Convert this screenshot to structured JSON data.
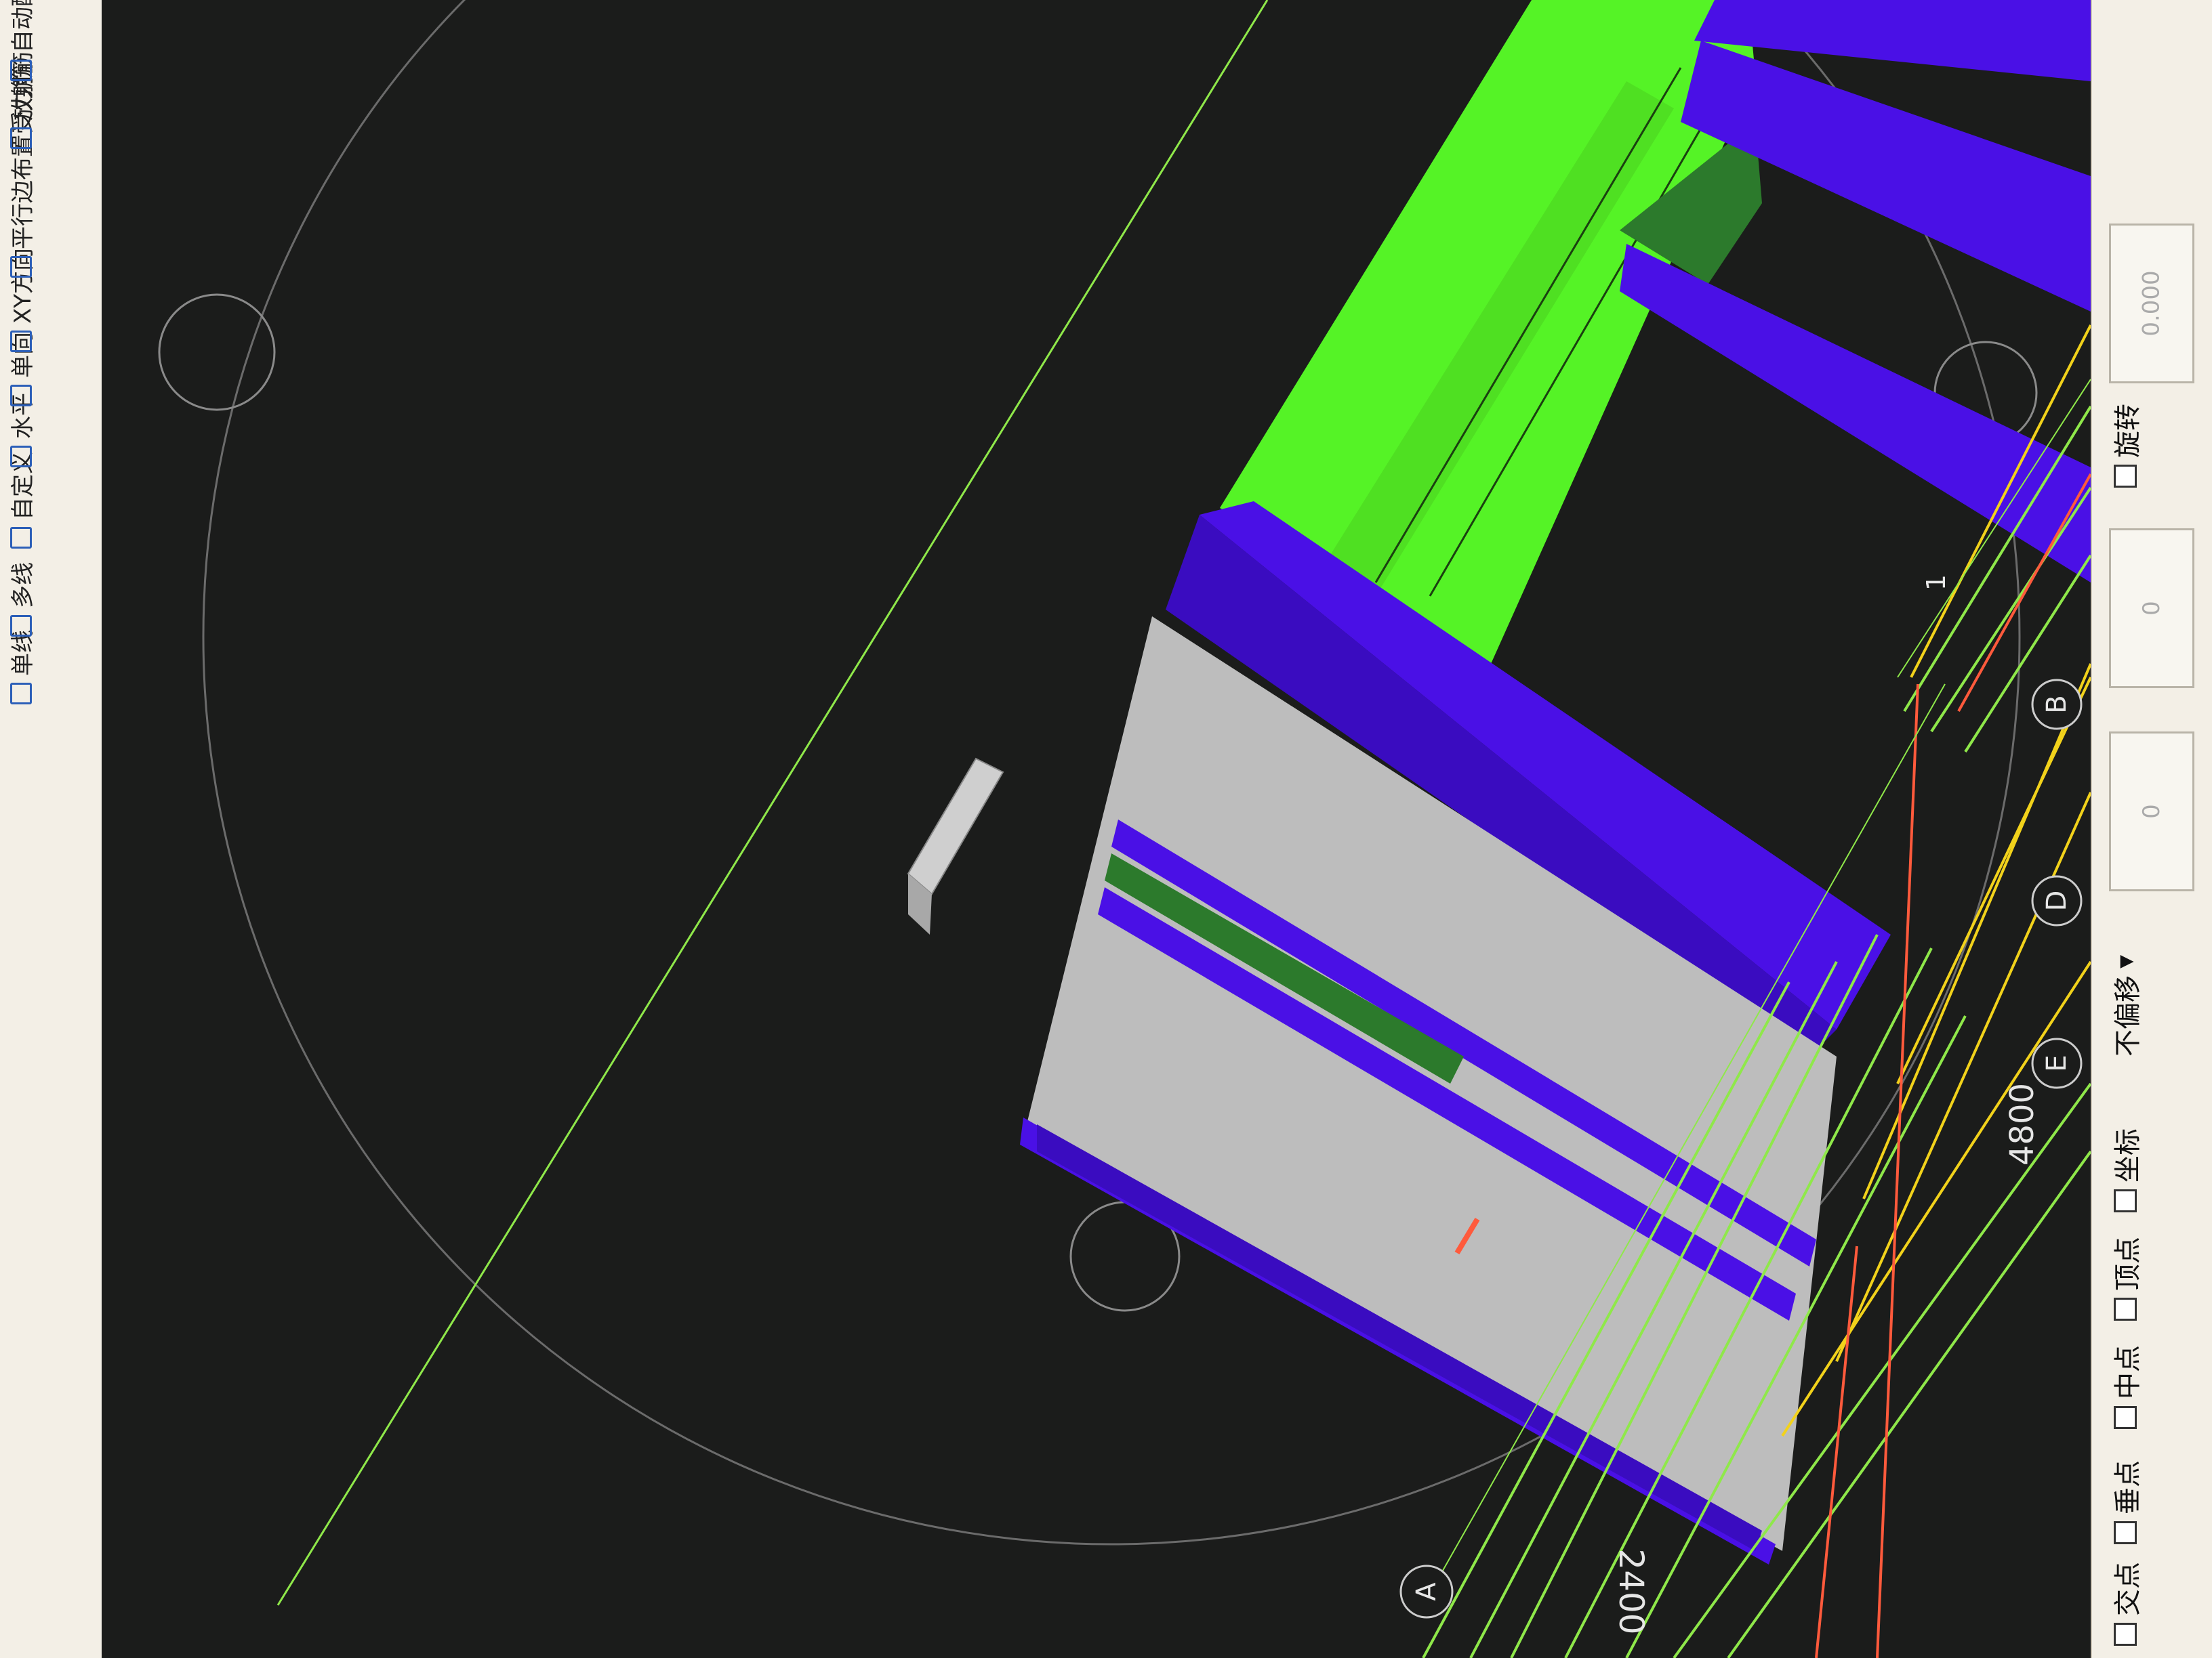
{
  "toolbar": {
    "items": [
      {
        "label": "单线",
        "icon": "wall-icon"
      },
      {
        "label": "多线",
        "icon": "multi-line-icon"
      },
      {
        "label": "自定义",
        "icon": "custom-icon"
      },
      {
        "label": "水平",
        "icon": "horizontal-icon"
      },
      {
        "label": "单向",
        "icon": "single-direction-icon"
      },
      {
        "label": "XY方向",
        "icon": "xy-direction-icon"
      },
      {
        "label": "平行边布置受力筋",
        "icon": "parallel-edge-icon"
      },
      {
        "label": "放射筋",
        "icon": "radial-rebar-icon"
      },
      {
        "label": "自动配筋",
        "icon": "auto-rebar-icon"
      }
    ]
  },
  "viewport": {
    "axis_labels": {
      "a": "A",
      "b": "B",
      "d": "D",
      "e": "E",
      "one": "1"
    },
    "dimension_labels": {
      "dim_2400": "2400",
      "dim_4800": "4800"
    },
    "colors": {
      "background": "#1b1c1b",
      "slab": "#bdbdbd",
      "beam": "#4a10e6",
      "column_green": "#55f326",
      "dark_green": "#2c7a2c",
      "axis_line": "#8fe84a",
      "yellow_line": "#f2d21b",
      "red_line": "#ff5a3c"
    }
  },
  "statusbar": {
    "snap_items": [
      {
        "label": "交点",
        "icon": "intersection-snap-icon"
      },
      {
        "label": "垂点",
        "icon": "perpendicular-snap-icon"
      },
      {
        "label": "中点",
        "icon": "midpoint-snap-icon"
      },
      {
        "label": "顶点",
        "icon": "vertex-snap-icon"
      },
      {
        "label": "坐标",
        "icon": "coordinate-snap-icon"
      }
    ],
    "offset_select": "不偏移",
    "x_value": "0",
    "y_value": "0",
    "rotate_label": "旋转",
    "rotate_value": "0.000"
  }
}
